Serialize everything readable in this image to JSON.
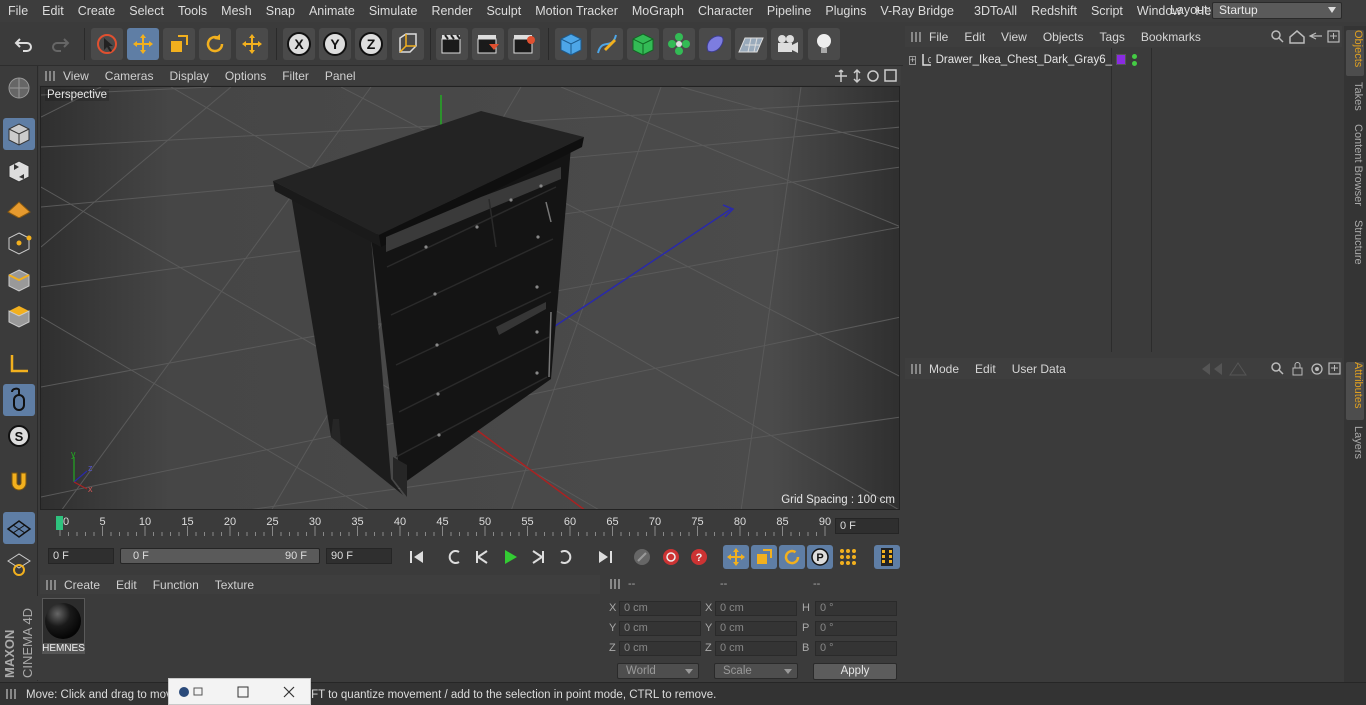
{
  "menubar": {
    "items": [
      "File",
      "Edit",
      "Create",
      "Select",
      "Tools",
      "Mesh",
      "Snap",
      "Animate",
      "Simulate",
      "Render",
      "Sculpt",
      "Motion Tracker",
      "MoGraph",
      "Character",
      "Pipeline",
      "Plugins",
      "V-Ray Bridge",
      "3DToAll",
      "Redshift",
      "Script",
      "Window",
      "Help"
    ],
    "layout_label": "Layout:",
    "layout_value": "Startup"
  },
  "toolbar": {
    "icons": [
      "undo-icon",
      "redo-icon",
      "live-selection-icon",
      "move-icon",
      "scale-icon",
      "rotate-icon",
      "recent-tool-icon",
      "x-axis-icon",
      "y-axis-icon",
      "z-axis-icon",
      "world-coordinates-icon",
      "render-view-icon",
      "render-picture-viewer-icon",
      "edit-render-settings-icon",
      "cube-icon",
      "pen-icon",
      "subdivision-icon",
      "cloner-icon",
      "deformer-icon",
      "floor-icon",
      "camera-icon",
      "light-icon"
    ],
    "axis_x": "X",
    "axis_y": "Y",
    "axis_z": "Z"
  },
  "viewport": {
    "menu": [
      "View",
      "Cameras",
      "Display",
      "Options",
      "Filter",
      "Panel"
    ],
    "label": "Perspective",
    "grid_spacing": "Grid Spacing : 100 cm"
  },
  "timeline": {
    "ticks": [
      "0",
      "5",
      "10",
      "15",
      "20",
      "25",
      "30",
      "35",
      "40",
      "45",
      "50",
      "55",
      "60",
      "65",
      "70",
      "75",
      "80",
      "85",
      "90"
    ],
    "current_frame": "0 F",
    "start_field": "0 F",
    "range_start": "0 F",
    "range_end": "90 F",
    "end_field": "90 F"
  },
  "material_panel": {
    "menu": [
      "Create",
      "Edit",
      "Function",
      "Texture"
    ],
    "material_name": "HEMNES"
  },
  "coordinates": {
    "headers": [
      "--",
      "--",
      "--"
    ],
    "rows": [
      {
        "a": "X",
        "av": "0 cm",
        "b": "X",
        "bv": "0 cm",
        "c": "H",
        "cv": "0 °"
      },
      {
        "a": "Y",
        "av": "0 cm",
        "b": "Y",
        "bv": "0 cm",
        "c": "P",
        "cv": "0 °"
      },
      {
        "a": "Z",
        "av": "0 cm",
        "b": "Z",
        "bv": "0 cm",
        "c": "B",
        "cv": "0 °"
      }
    ],
    "mode_world": "World",
    "mode_scale": "Scale",
    "apply": "Apply"
  },
  "objects_panel": {
    "menu": [
      "File",
      "Edit",
      "View",
      "Objects",
      "Tags",
      "Bookmarks"
    ],
    "object_name": "Drawer_Ikea_Chest_Dark_Gray6_",
    "tag_color": "#8a2be2"
  },
  "attributes_panel": {
    "menu": [
      "Mode",
      "Edit",
      "User Data"
    ]
  },
  "right_tabs": {
    "top": [
      "Objects",
      "Takes",
      "Content Browser",
      "Structure"
    ],
    "bottom": [
      "Attributes",
      "Layers"
    ]
  },
  "status": {
    "text": "Move: Click and drag to move elements. Hold down SHIFT to quantize movement / add to the selection in point mode, CTRL to remove."
  },
  "brand": {
    "line1": "MAXON",
    "line2": "CINEMA 4D"
  },
  "colors": {
    "accent": "#5f7ea5",
    "active_tab": "#e0a020"
  }
}
